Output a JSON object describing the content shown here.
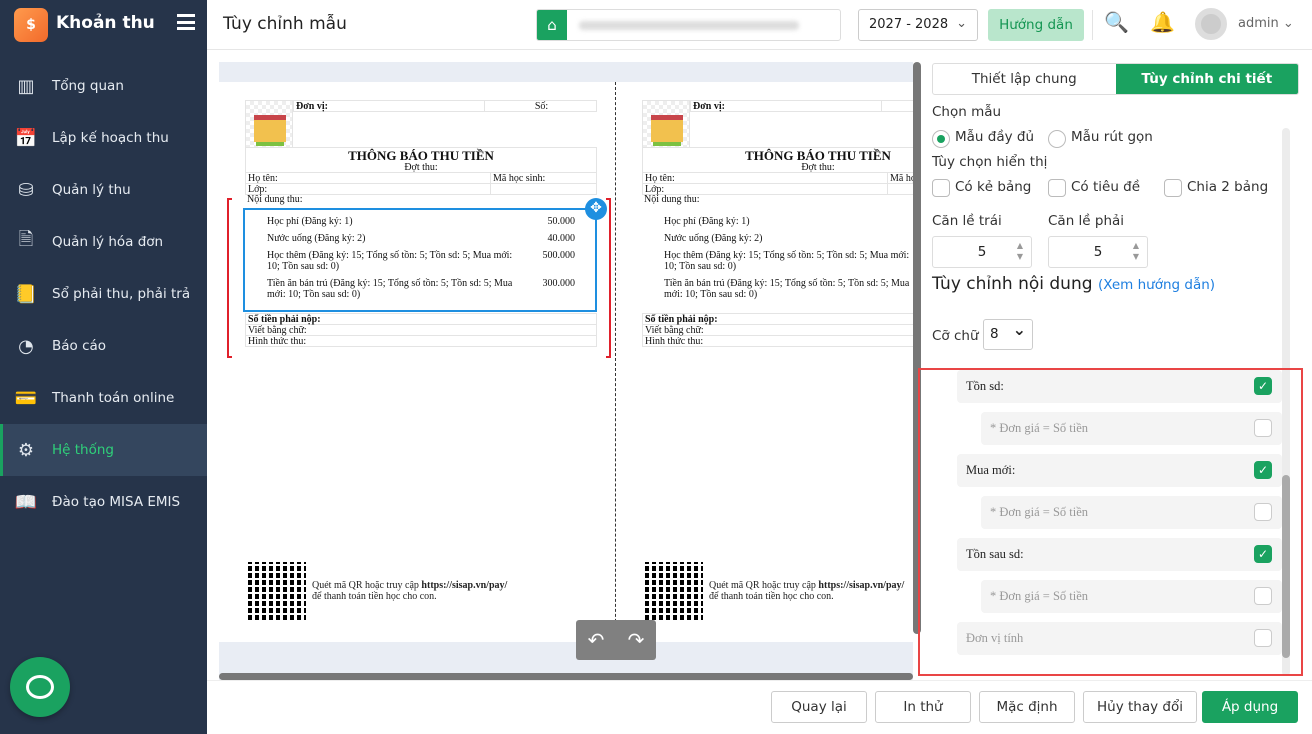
{
  "app": {
    "name": "Khoản thu",
    "logo_text": "$"
  },
  "sidebar": {
    "items": [
      {
        "label": "Tổng quan",
        "icon": "bar-chart-icon",
        "glyph": "▥"
      },
      {
        "label": "Lập kế hoạch thu",
        "icon": "calendar-dollar-icon",
        "glyph": "📅"
      },
      {
        "label": "Quản lý thu",
        "icon": "hand-coin-icon",
        "glyph": "⛁"
      },
      {
        "label": "Quản lý hóa đơn",
        "icon": "invoice-icon",
        "glyph": "🗎"
      },
      {
        "label": "Sổ phải thu, phải trả",
        "icon": "ledger-icon",
        "glyph": "📒"
      },
      {
        "label": "Báo cáo",
        "icon": "pie-chart-icon",
        "glyph": "◔"
      },
      {
        "label": "Thanh toán online",
        "icon": "card-icon",
        "glyph": "💳"
      },
      {
        "label": "Hệ thống",
        "icon": "gear-icon",
        "glyph": "⚙",
        "active": true
      },
      {
        "label": "Đào tạo MISA EMIS",
        "icon": "book-icon",
        "glyph": "📖"
      }
    ]
  },
  "header": {
    "title": "Tùy chỉnh mẫu",
    "school_year": "2027 - 2028",
    "guide": "Hướng dẫn",
    "user": "admin"
  },
  "receipt": {
    "unit": "Đơn vị:",
    "number": "Số:",
    "title": "THÔNG BÁO THU TIỀN",
    "period": "Đợt thu:",
    "name": "Họ tên:",
    "student_code": "Mã học sinh:",
    "class": "Lớp:",
    "content": "Nội dung thu:",
    "items": [
      {
        "name": "Học phí (Đăng ký: 1)",
        "amount": "50.000"
      },
      {
        "name": "Nước uống (Đăng ký: 2)",
        "amount": "40.000"
      },
      {
        "name": "Học thêm (Đăng ký: 15; Tổng số tồn: 5; Tồn sd: 5; Mua mới: 10; Tồn sau sd: 0)",
        "amount": "500.000"
      },
      {
        "name": "Tiền ăn bán trú (Đăng ký: 15; Tổng số tồn: 5; Tồn sd: 5; Mua mới: 10; Tồn sau sd: 0)",
        "amount": "300.000"
      }
    ],
    "total": "Số tiền phải nộp:",
    "in_words": "Viết bằng chữ:",
    "method": "Hình thức thu:",
    "qr_text": "Quét mã QR hoặc truy cập ",
    "qr_url": "https://sisap.vn/pay/",
    "qr_text2": "để thanh toán tiền học cho con."
  },
  "panel": {
    "tabs": [
      {
        "label": "Thiết lập chung"
      },
      {
        "label": "Tùy chỉnh chi tiết",
        "active": true
      }
    ],
    "template_label": "Chọn mẫu",
    "template_full": "Mẫu đầy đủ",
    "template_short": "Mẫu rút gọn",
    "template_selected": "full",
    "display_label": "Tùy chọn hiển thị",
    "show_grid": "Có kẻ bảng",
    "show_title": "Có tiêu đề",
    "split_2": "Chia 2 bảng",
    "margin_left_label": "Căn lề trái",
    "margin_left": "5",
    "margin_right_label": "Căn lề phải",
    "margin_right": "5",
    "content_title": "Tùy chỉnh nội dung",
    "content_help": "(Xem hướng dẫn)",
    "font_size_label": "Cỡ chữ",
    "font_size": "8",
    "options": [
      {
        "label": "Tồn sd:",
        "checked": true,
        "sub": false
      },
      {
        "label": "* Đơn giá = Số tiền",
        "checked": false,
        "sub": true
      },
      {
        "label": "Mua mới:",
        "checked": true,
        "sub": false
      },
      {
        "label": "* Đơn giá = Số tiền",
        "checked": false,
        "sub": true
      },
      {
        "label": "Tồn sau sd:",
        "checked": true,
        "sub": false
      },
      {
        "label": "* Đơn giá = Số tiền",
        "checked": false,
        "sub": true
      },
      {
        "label": "Đơn vị tính",
        "checked": false,
        "sub": false,
        "muted": true
      }
    ]
  },
  "footer": {
    "back": "Quay lại",
    "print": "In thử",
    "default": "Mặc định",
    "cancel": "Hủy thay đổi",
    "apply": "Áp dụng"
  },
  "colors": {
    "primary": "#1aa260",
    "sidebar": "#26344a",
    "highlight": "#1e8fe0",
    "annotation": "#e94545"
  }
}
